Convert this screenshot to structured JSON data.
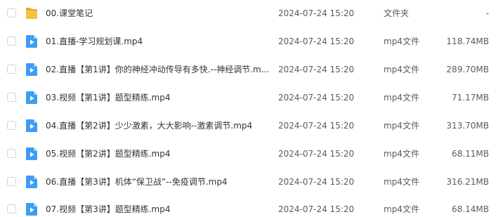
{
  "files": [
    {
      "name": "00.课堂笔记",
      "date": "2024-07-24 15:20",
      "type": "文件夹",
      "size": "-",
      "icon": "folder-icon"
    },
    {
      "name": "01.直播-学习规划课.mp4",
      "date": "2024-07-24 15:20",
      "type": "mp4文件",
      "size": "118.74MB",
      "icon": "video-file-icon"
    },
    {
      "name": "02.直播【第1讲】你的神经冲动传导有多快.--神经调节.m...",
      "date": "2024-07-24 15:20",
      "type": "mp4文件",
      "size": "289.70MB",
      "icon": "video-file-icon"
    },
    {
      "name": "03.视频【第1讲】题型精练.mp4",
      "date": "2024-07-24 15:20",
      "type": "mp4文件",
      "size": "71.17MB",
      "icon": "video-file-icon"
    },
    {
      "name": "04.直播【第2讲】少少激素，大大影响--激素调节.mp4",
      "date": "2024-07-24 15:20",
      "type": "mp4文件",
      "size": "313.70MB",
      "icon": "video-file-icon"
    },
    {
      "name": "05.视频【第2讲】题型精练.mp4",
      "date": "2024-07-24 15:20",
      "type": "mp4文件",
      "size": "68.11MB",
      "icon": "video-file-icon"
    },
    {
      "name": "06.直播【第3讲】机体“保卫战”--免疫调节.mp4",
      "date": "2024-07-24 15:20",
      "type": "mp4文件",
      "size": "316.21MB",
      "icon": "video-file-icon"
    },
    {
      "name": "07.视频【第3讲】题型精练.mp4",
      "date": "2024-07-24 15:20",
      "type": "mp4文件",
      "size": "68.14MB",
      "icon": "video-file-icon"
    }
  ],
  "colors": {
    "folder": "#f7c143",
    "video": "#3d9df6"
  }
}
